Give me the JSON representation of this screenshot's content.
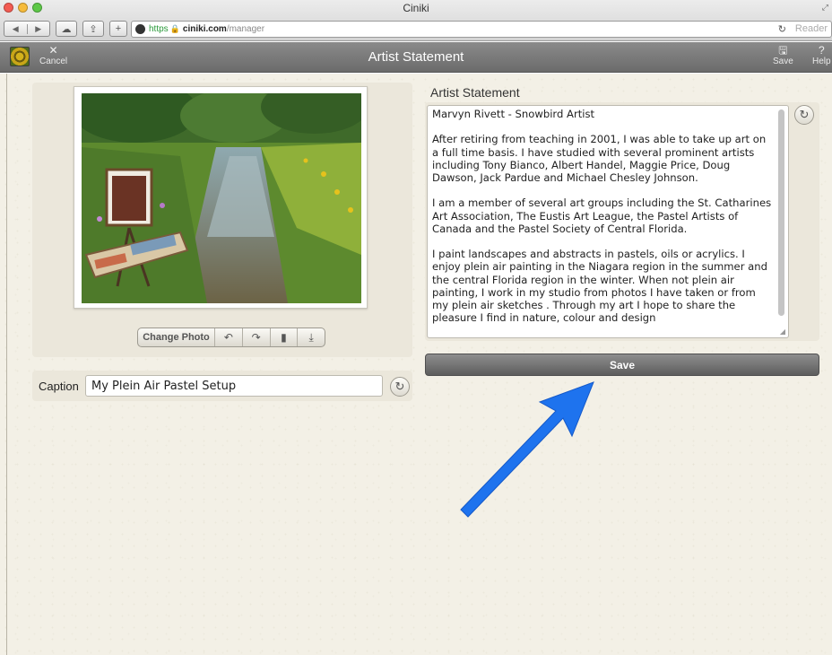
{
  "browser": {
    "window_title": "Ciniki",
    "url_scheme": "https",
    "url_domain": "ciniki.com",
    "url_path": "/manager",
    "reader_label": "Reader"
  },
  "header": {
    "title": "Artist Statement",
    "cancel_label": "Cancel",
    "save_label": "Save",
    "help_label": "Help"
  },
  "photo": {
    "change_label": "Change Photo",
    "tools": [
      "rotate-left-icon",
      "rotate-right-icon",
      "trash-icon",
      "download-icon"
    ]
  },
  "caption": {
    "label": "Caption",
    "value": "My Plein Air Pastel Setup"
  },
  "statement": {
    "label": "Artist Statement",
    "text": "Marvyn Rivett - Snowbird Artist\n\nAfter retiring from teaching in 2001, I was able to take up art on a full time basis. I have studied with several prominent artists including Tony Bianco, Albert Handel, Maggie Price, Doug Dawson, Jack Pardue and Michael Chesley Johnson.\n\nI am a member of several art groups including the St. Catharines Art Association, The Eustis Art League, the Pastel Artists of Canada and the Pastel Society of Central Florida.\n\nI paint landscapes and abstracts in pastels, oils or acrylics. I enjoy plein air painting in the Niagara region in the summer and the central Florida region in the winter. When not plein air painting, I work in my studio from photos I have taken or from my plein air sketches . Through my art I hope to share the pleasure I find in nature, colour and design"
  },
  "save_button": {
    "label": "Save"
  },
  "colors": {
    "background": "#f3f0e6",
    "header": "#7a7a7a",
    "annotation_arrow": "#1e73ee"
  }
}
